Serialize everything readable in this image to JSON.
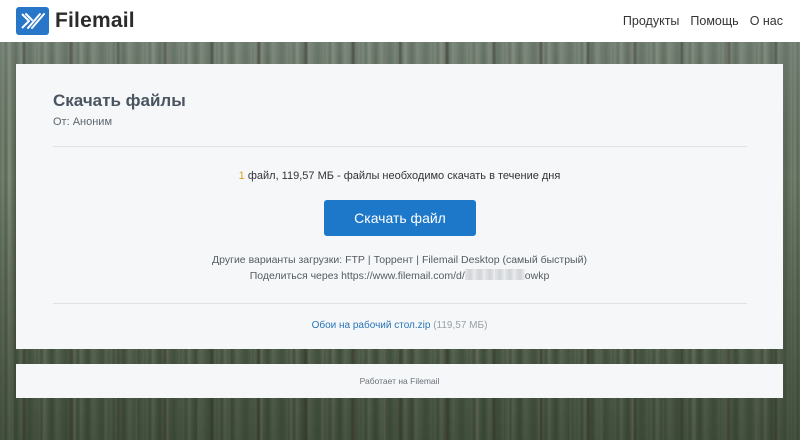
{
  "brand": {
    "name": "Filemail"
  },
  "nav": {
    "items": [
      "Продукты",
      "Помощь",
      "О нас"
    ]
  },
  "card": {
    "title": "Скачать файлы",
    "from": "От: Аноним",
    "summary": {
      "count": "1",
      "text": " файл, 119,57 МБ - файлы необходимо скачать в течение дня"
    },
    "download_button": "Скачать файл",
    "alt_options": {
      "prefix": "Другие варианты загрузки:",
      "ftp": "FTP",
      "torrent": "Торрент",
      "desktop": "Filemail Desktop (самый быстрый)"
    },
    "share": {
      "prefix": "Поделиться через",
      "url_start": "https://www.filemail.com/d/",
      "url_end": "owkp"
    },
    "file": {
      "name": "Обои на рабочий стол.zip",
      "size": "(119,57 МБ)"
    }
  },
  "footer": {
    "text": "Работает на Filemail"
  },
  "colors": {
    "accent": "#1d78c9",
    "logo": "#2876c8"
  }
}
